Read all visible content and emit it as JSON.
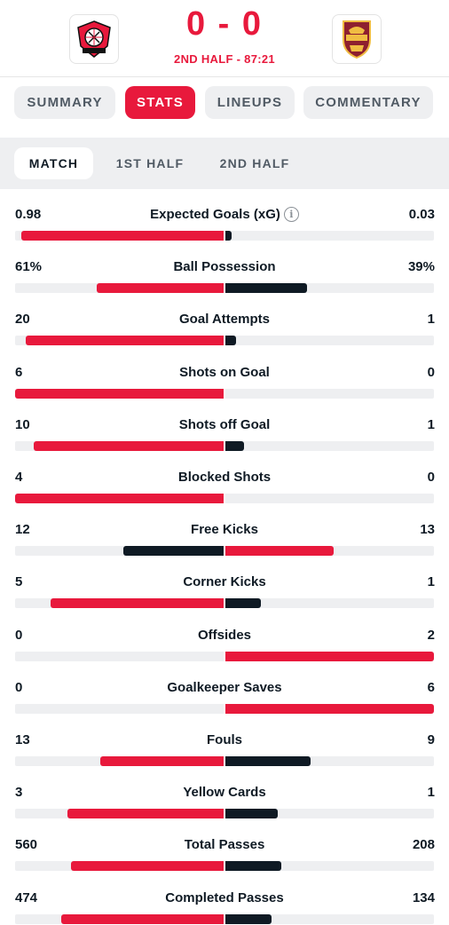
{
  "match": {
    "score": "0 - 0",
    "status": "2ND HALF - 87:21",
    "home_team_logo": "bayer-leverkusen-crest",
    "away_team_logo": "as-roma-crest"
  },
  "tabs": [
    {
      "label": "SUMMARY",
      "active": false
    },
    {
      "label": "STATS",
      "active": true
    },
    {
      "label": "LINEUPS",
      "active": false
    },
    {
      "label": "COMMENTARY",
      "active": false
    }
  ],
  "periods": [
    {
      "label": "MATCH",
      "active": true
    },
    {
      "label": "1ST HALF",
      "active": false
    },
    {
      "label": "2ND HALF",
      "active": false
    }
  ],
  "colors": {
    "accent": "#e8193c",
    "dark": "#0f1a24",
    "track": "#eeeff1"
  },
  "stats": [
    {
      "label": "Expected Goals (xG)",
      "home": "0.98",
      "away": "0.03",
      "home_share": 0.97,
      "away_share": 0.03,
      "info": true
    },
    {
      "label": "Ball Possession",
      "home": "61%",
      "away": "39%",
      "home_share": 0.61,
      "away_share": 0.39
    },
    {
      "label": "Goal Attempts",
      "home": "20",
      "away": "1",
      "home_share": 0.95,
      "away_share": 0.05
    },
    {
      "label": "Shots on Goal",
      "home": "6",
      "away": "0",
      "home_share": 1.0,
      "away_share": 0.0
    },
    {
      "label": "Shots off Goal",
      "home": "10",
      "away": "1",
      "home_share": 0.91,
      "away_share": 0.09
    },
    {
      "label": "Blocked Shots",
      "home": "4",
      "away": "0",
      "home_share": 1.0,
      "away_share": 0.0
    },
    {
      "label": "Free Kicks",
      "home": "12",
      "away": "13",
      "home_share": 0.48,
      "away_share": 0.52
    },
    {
      "label": "Corner Kicks",
      "home": "5",
      "away": "1",
      "home_share": 0.83,
      "away_share": 0.17
    },
    {
      "label": "Offsides",
      "home": "0",
      "away": "2",
      "home_share": 0.0,
      "away_share": 1.0
    },
    {
      "label": "Goalkeeper Saves",
      "home": "0",
      "away": "6",
      "home_share": 0.0,
      "away_share": 1.0
    },
    {
      "label": "Fouls",
      "home": "13",
      "away": "9",
      "home_share": 0.59,
      "away_share": 0.41
    },
    {
      "label": "Yellow Cards",
      "home": "3",
      "away": "1",
      "home_share": 0.75,
      "away_share": 0.25
    },
    {
      "label": "Total Passes",
      "home": "560",
      "away": "208",
      "home_share": 0.73,
      "away_share": 0.27
    },
    {
      "label": "Completed Passes",
      "home": "474",
      "away": "134",
      "home_share": 0.78,
      "away_share": 0.22
    }
  ]
}
